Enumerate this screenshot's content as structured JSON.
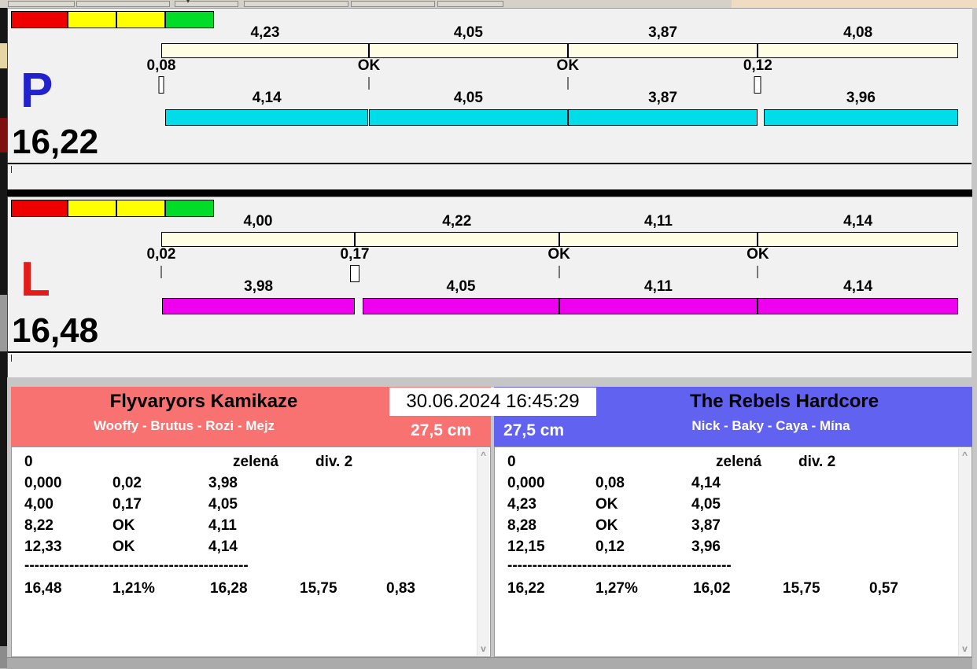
{
  "window": {
    "datetime": "30.06.2024 16:45:29"
  },
  "lights": [
    "#EE0000",
    "#FFFF00",
    "#FFFF00",
    "#00DC28"
  ],
  "lanes": [
    {
      "letter": "P",
      "letter_color": "#2222CC",
      "total": "16,22",
      "bar_color": "#00DCE8",
      "splits_top": {
        "labels": [
          "4,23",
          "4,05",
          "3,87",
          "4,08"
        ],
        "values": [
          4.23,
          4.05,
          3.87,
          4.08
        ]
      },
      "markers": {
        "labels": [
          "0,08",
          "OK",
          "OK",
          "0,12"
        ],
        "values": [
          0.08,
          0,
          0,
          0.12
        ]
      },
      "splits_bottom": {
        "labels": [
          "4,14",
          "4,05",
          "3,87",
          "3,96"
        ],
        "values": [
          4.14,
          4.05,
          3.87,
          3.96
        ],
        "starts": [
          0.08,
          4.23,
          8.28,
          12.27
        ]
      }
    },
    {
      "letter": "L",
      "letter_color": "#E21B1B",
      "total": "16,48",
      "bar_color": "#EE00EE",
      "splits_top": {
        "labels": [
          "4,00",
          "4,22",
          "4,11",
          "4,14"
        ],
        "values": [
          4.0,
          4.22,
          4.11,
          4.14
        ]
      },
      "markers": {
        "labels": [
          "0,02",
          "0,17",
          "OK",
          "OK"
        ],
        "values": [
          0.02,
          0.17,
          0,
          0
        ]
      },
      "splits_bottom": {
        "labels": [
          "3,98",
          "4,05",
          "4,11",
          "4,14"
        ],
        "values": [
          3.98,
          4.05,
          4.11,
          4.14
        ],
        "starts": [
          0.02,
          4.17,
          8.22,
          12.33
        ]
      }
    }
  ],
  "teams": [
    {
      "name": "Flyvaryors Kamikaze",
      "dogs": "Wooffy - Brutus - Rozi - Mejz",
      "jump_height": "27,5 cm",
      "header_color": "#F87272",
      "info_row": {
        "attempt": "0",
        "lights": "zelená",
        "division": "div. 2"
      },
      "rows": [
        [
          "0,000",
          "0,02",
          "3,98"
        ],
        [
          "4,00",
          "0,17",
          "4,05"
        ],
        [
          "8,22",
          "OK",
          "4,11"
        ],
        [
          "12,33",
          "OK",
          "4,14"
        ]
      ],
      "separator": "---------------------------------------------",
      "totals": [
        "16,48",
        "1,21%",
        "16,28",
        "15,75",
        "0,83"
      ]
    },
    {
      "name": "The Rebels Hardcore",
      "dogs": "Nick - Baky - Caya - Mína",
      "jump_height": "27,5 cm",
      "header_color": "#6262F0",
      "info_row": {
        "attempt": "0",
        "lights": "zelená",
        "division": "div. 2"
      },
      "rows": [
        [
          "0,000",
          "0,08",
          "4,14"
        ],
        [
          "4,23",
          "OK",
          "4,05"
        ],
        [
          "8,28",
          "OK",
          "3,87"
        ],
        [
          "12,15",
          "0,12",
          "3,96"
        ]
      ],
      "separator": "---------------------------------------------",
      "totals": [
        "16,22",
        "1,27%",
        "16,02",
        "15,75",
        "0,57"
      ]
    }
  ],
  "scrollbar": {
    "up": "^",
    "down": "v"
  }
}
